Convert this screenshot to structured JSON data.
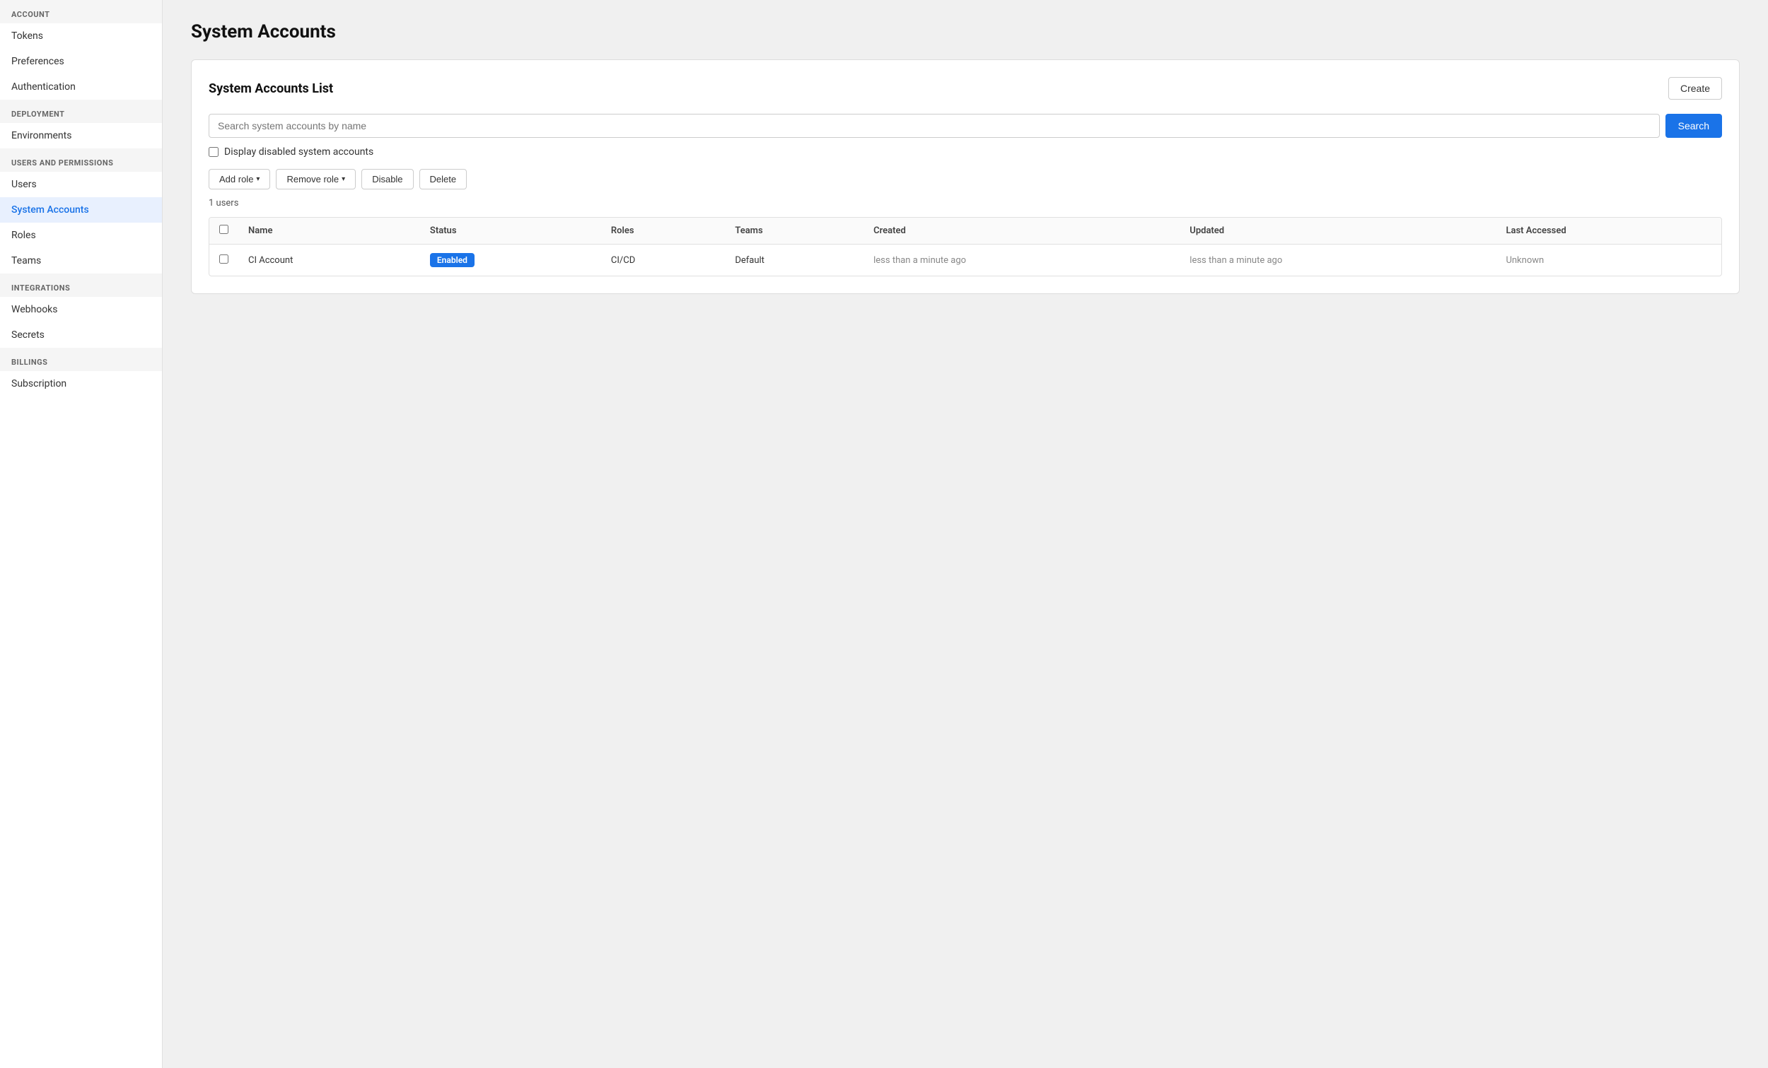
{
  "sidebar": {
    "sections": [
      {
        "label": "ACCOUNT",
        "items": [
          {
            "id": "tokens",
            "text": "Tokens",
            "active": false
          },
          {
            "id": "preferences",
            "text": "Preferences",
            "active": false
          },
          {
            "id": "authentication",
            "text": "Authentication",
            "active": false
          }
        ]
      },
      {
        "label": "DEPLOYMENT",
        "items": [
          {
            "id": "environments",
            "text": "Environments",
            "active": false
          }
        ]
      },
      {
        "label": "USERS AND PERMISSIONS",
        "items": [
          {
            "id": "users",
            "text": "Users",
            "active": false
          },
          {
            "id": "system-accounts",
            "text": "System Accounts",
            "active": true
          },
          {
            "id": "roles",
            "text": "Roles",
            "active": false
          },
          {
            "id": "teams",
            "text": "Teams",
            "active": false
          }
        ]
      },
      {
        "label": "INTEGRATIONS",
        "items": [
          {
            "id": "webhooks",
            "text": "Webhooks",
            "active": false
          },
          {
            "id": "secrets",
            "text": "Secrets",
            "active": false
          }
        ]
      },
      {
        "label": "BILLINGS",
        "items": [
          {
            "id": "subscription",
            "text": "Subscription",
            "active": false
          }
        ]
      }
    ]
  },
  "page": {
    "title": "System Accounts"
  },
  "card": {
    "title": "System Accounts List",
    "create_label": "Create",
    "search_placeholder": "Search system accounts by name",
    "search_label": "Search",
    "checkbox_label": "Display disabled system accounts",
    "user_count": "1 users",
    "actions": [
      {
        "id": "add-role",
        "label": "Add role",
        "has_chevron": true
      },
      {
        "id": "remove-role",
        "label": "Remove role",
        "has_chevron": true
      },
      {
        "id": "disable",
        "label": "Disable",
        "has_chevron": false
      },
      {
        "id": "delete",
        "label": "Delete",
        "has_chevron": false
      }
    ],
    "table": {
      "columns": [
        "Name",
        "Status",
        "Roles",
        "Teams",
        "Created",
        "Updated",
        "Last Accessed"
      ],
      "rows": [
        {
          "name": "CI Account",
          "status": "Enabled",
          "status_color": "#1a73e8",
          "roles": "CI/CD",
          "teams": "Default",
          "created": "less than a minute ago",
          "updated": "less than a minute ago",
          "last_accessed": "Unknown"
        }
      ]
    }
  }
}
